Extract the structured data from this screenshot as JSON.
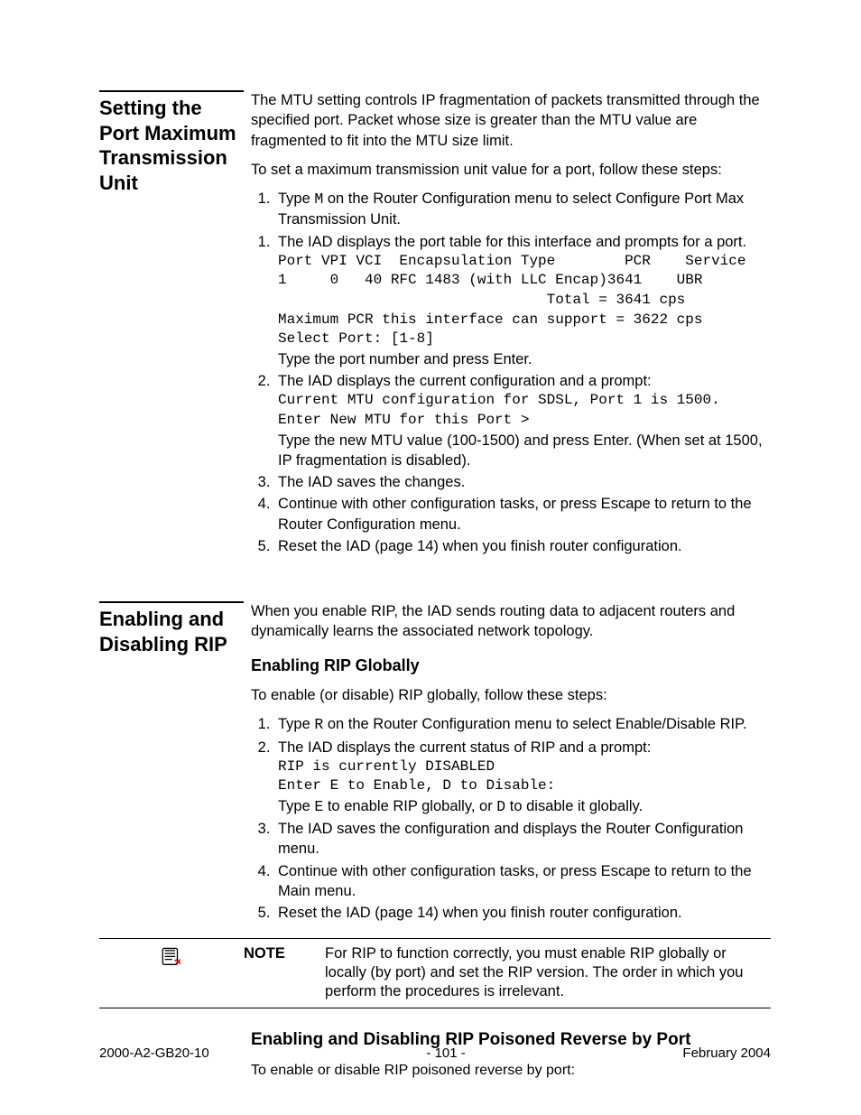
{
  "sections": [
    {
      "heading": "Setting the Port Maxi­mum Transmis­sion Unit",
      "intro1": "The MTU setting controls IP fragmentation of packets transmitted through the specified port. Packet whose size is greater than the MTU value are fragmented to fit into the MTU size limit.",
      "intro2": "To set a maximum transmission unit value for a port, follow these steps:",
      "step1_pre": "Type ",
      "step1_code": "M",
      "step1_post": " on the Router Configuration menu to select Configure Port Max Transmission Unit.",
      "step1b": "The IAD displays the port table for this interface and prompts for a port.",
      "port_table": "Port VPI VCI  Encapsulation Type        PCR    Service\n1     0   40 RFC 1483 (with LLC Encap)3641    UBR\n                               Total = 3641 cps\nMaximum PCR this interface can support = 3622 cps\nSelect Port: [1-8]",
      "step1b_post": "Type the port number and press Enter.",
      "step2": "The IAD displays the current configuration and a prompt:",
      "step2_code": "Current MTU configuration for SDSL, Port 1 is 1500.\nEnter New MTU for this Port >",
      "step2_post": "Type the new MTU value (100-1500) and press Enter. (When set at 1500, IP fragmentation is disabled).",
      "step3": "The IAD saves the changes.",
      "step4": "Continue with other configuration tasks, or press Escape to return to the Router Configuration menu.",
      "step5": "Reset the IAD (page 14) when you finish router configuration."
    },
    {
      "heading": "Enabling and Dis­abling RIP",
      "intro": "When you enable RIP, the IAD sends routing data to adjacent routers and dynamically learns the associated network topology.",
      "subhead1": "Enabling RIP Globally",
      "subintro": "To enable (or disable) RIP globally, follow these steps:",
      "r_step1_pre": "Type ",
      "r_step1_code": "R",
      "r_step1_post": " on the Router Configuration menu to select Enable/Disable RIP.",
      "r_step2": "The IAD displays the current status of RIP and a prompt:",
      "r_step2_code": "RIP is currently DISABLED\nEnter E to Enable, D to Disable:",
      "r_step2_post_a": "Type ",
      "r_step2_post_b": "E",
      "r_step2_post_c": " to enable RIP globally, or ",
      "r_step2_post_d": "D",
      "r_step2_post_e": " to disable it globally.",
      "r_step3": "The IAD saves the configuration and displays the Router Configuration menu.",
      "r_step4": "Continue with other configuration tasks, or press Escape to return to the Main menu.",
      "r_step5": "Reset the IAD (page 14) when you finish router configuration.",
      "note_label": "NOTE",
      "note_text": "For RIP to function correctly, you must enable RIP globally or locally (by port) and set the RIP version. The order in which you perform the procedures is irrelevant.",
      "subhead2": "Enabling and Disabling RIP Poisoned Reverse by Port",
      "subintro2": "To enable or disable RIP poisoned reverse by port:"
    }
  ],
  "footer": {
    "left": "2000-A2-GB20-10",
    "center": "- 101 -",
    "right": "February 2004"
  }
}
